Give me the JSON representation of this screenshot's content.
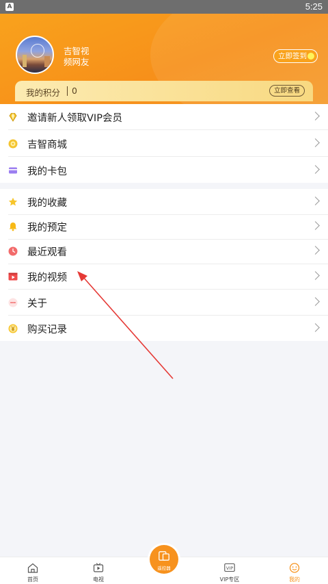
{
  "status_bar": {
    "notification_icon_letter": "A",
    "time": "5:25"
  },
  "profile": {
    "username": "吉智视频网友",
    "checkin_label": "立即签到"
  },
  "points": {
    "label": "我的积分",
    "value": "0",
    "view_label": "立即查看"
  },
  "menu_group_1": [
    {
      "label": "邀请新人领取VIP会员",
      "icon": "diamond-icon"
    },
    {
      "label": "吉智商城",
      "icon": "shop-coin-icon"
    },
    {
      "label": "我的卡包",
      "icon": "card-wallet-icon"
    }
  ],
  "menu_group_2": [
    {
      "label": "我的收藏",
      "icon": "star-icon"
    },
    {
      "label": "我的预定",
      "icon": "bell-icon"
    },
    {
      "label": "最近观看",
      "icon": "clock-icon"
    },
    {
      "label": "我的视频",
      "icon": "video-icon"
    },
    {
      "label": "关于",
      "icon": "ellipsis-icon"
    },
    {
      "label": "购买记录",
      "icon": "yuan-coin-icon"
    }
  ],
  "tabbar": {
    "home": "首页",
    "tv": "电视",
    "center": "遥控器",
    "vip": "VIP专区",
    "mine": "我的",
    "vip_icon_text": "VIP"
  },
  "colors": {
    "accent": "#f7931e",
    "annotation": "#e53935"
  }
}
